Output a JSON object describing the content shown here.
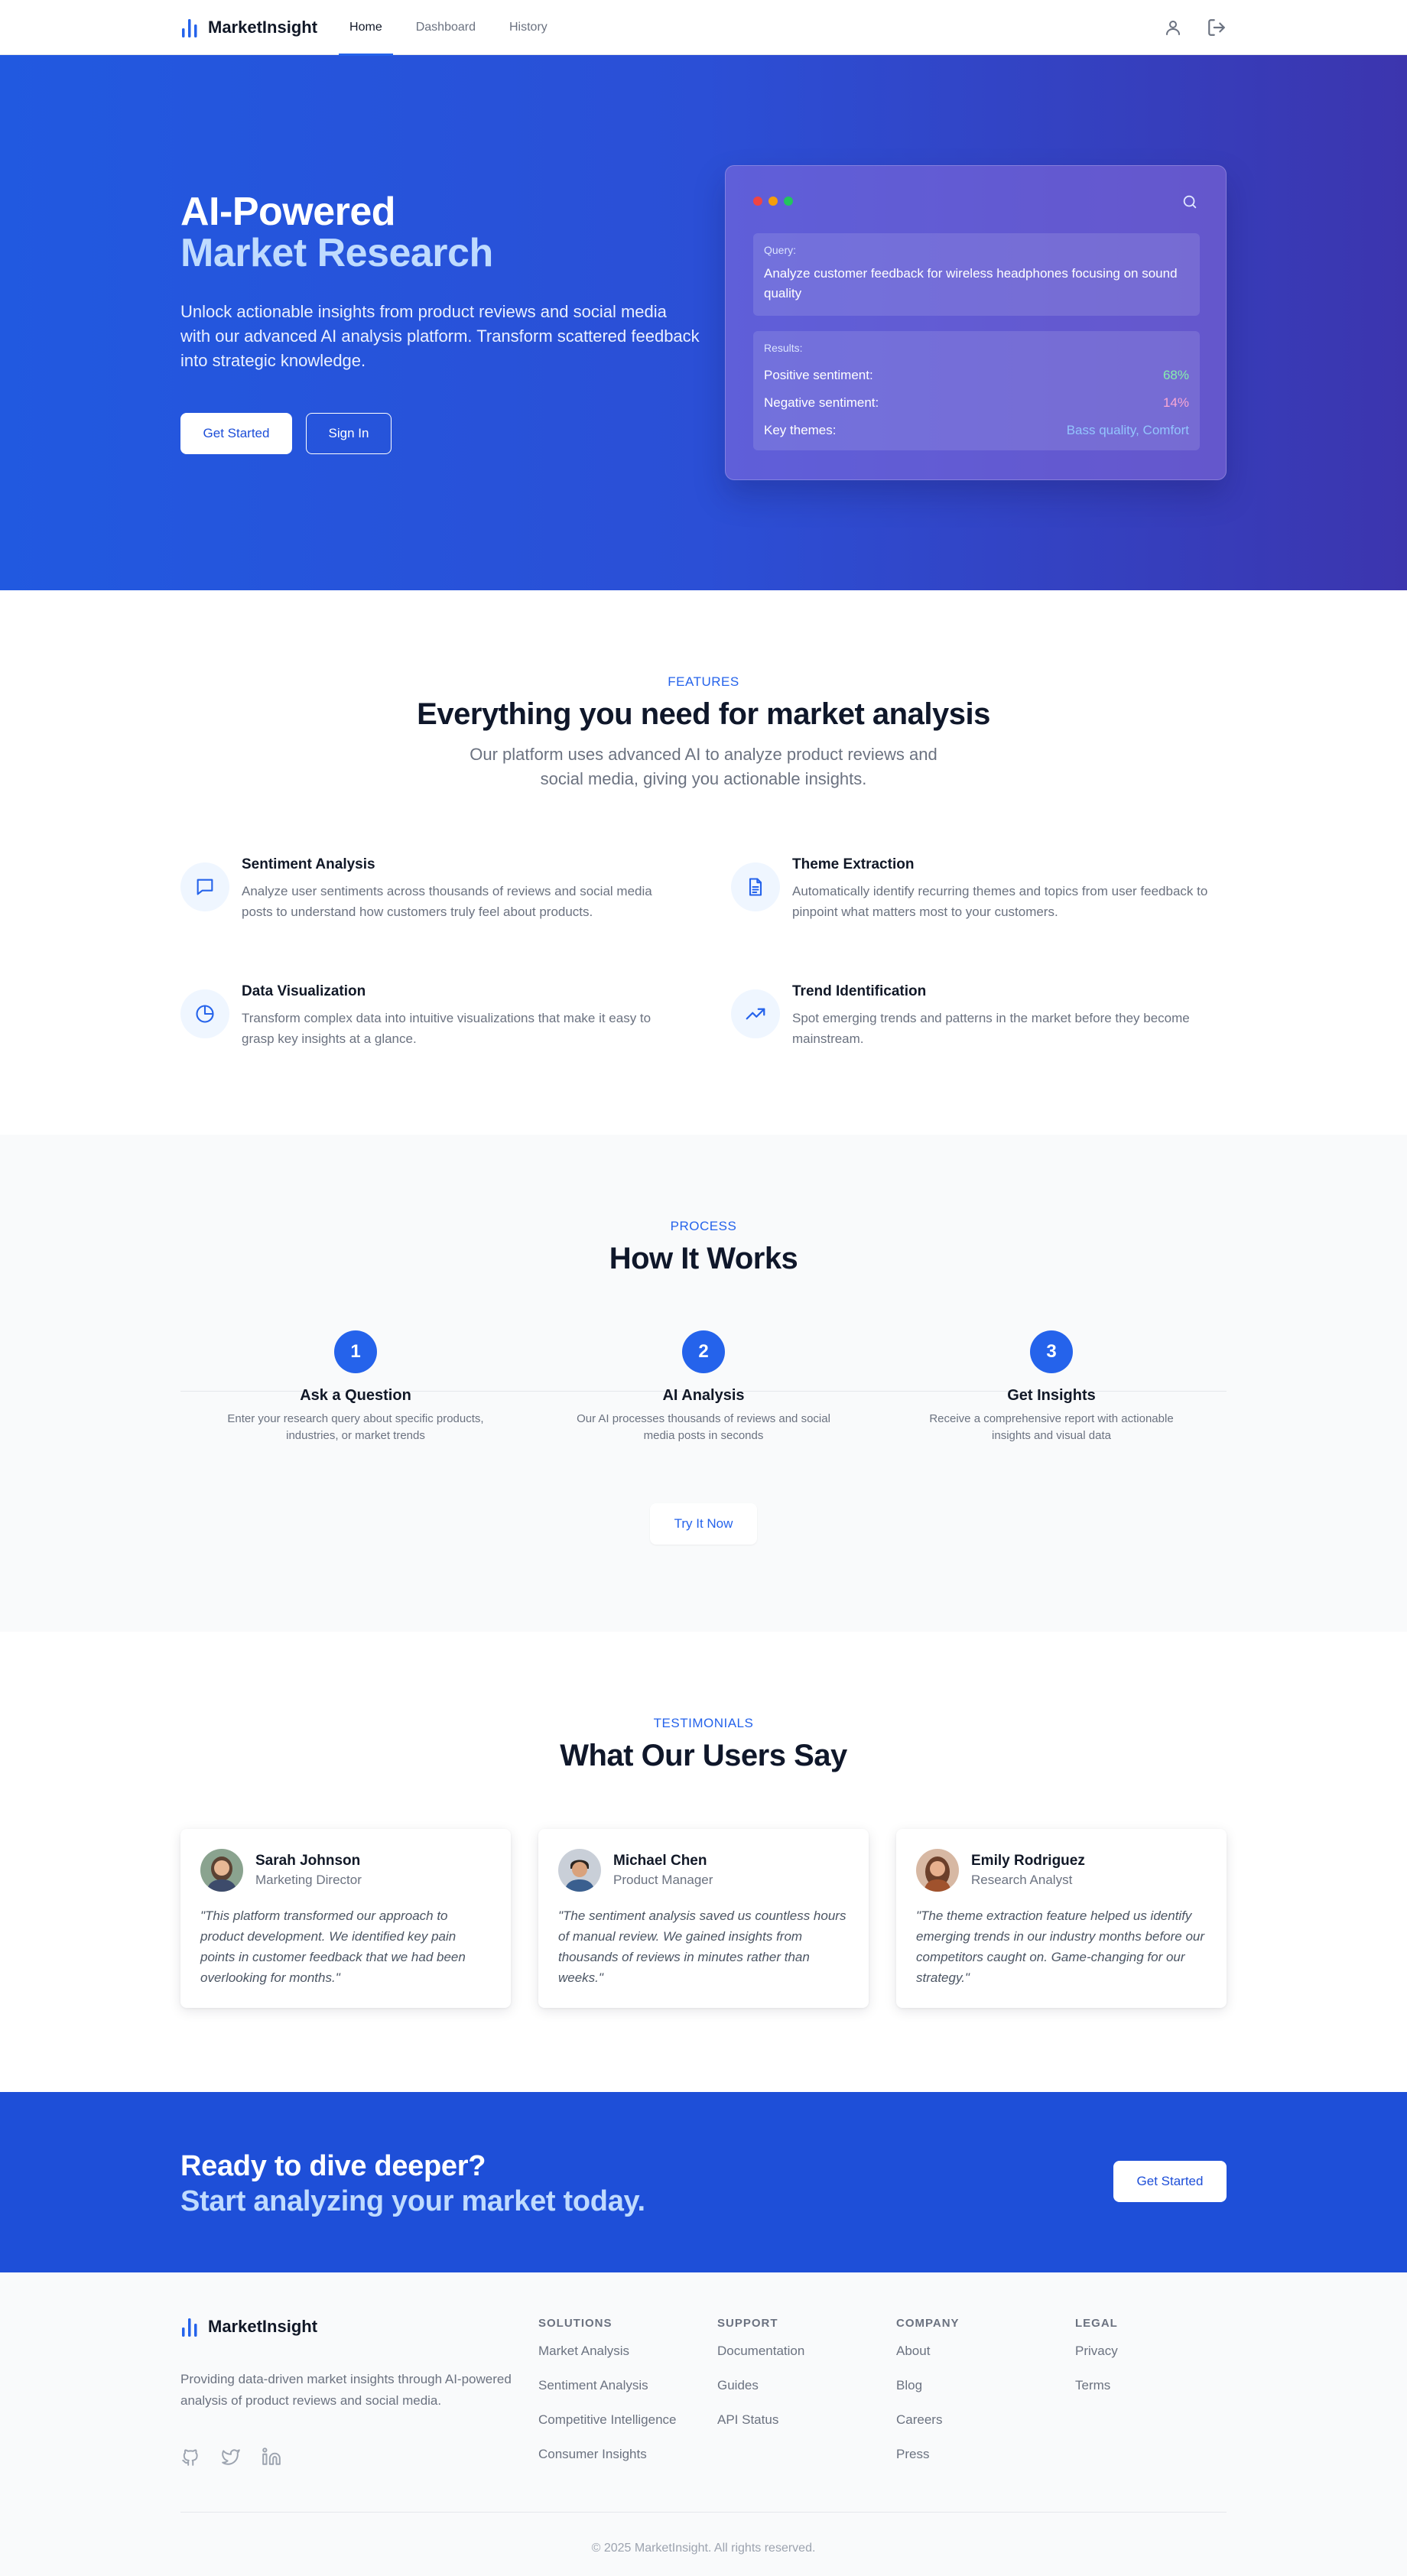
{
  "brand": {
    "name": "MarketInsight"
  },
  "colors": {
    "accent": "#2563eb",
    "hero_start": "#2159e0",
    "hero_end": "#3c35ae",
    "positive": "#86efac",
    "negative": "#f9a8d4",
    "themes": "#93c5fd"
  },
  "nav": {
    "links": [
      {
        "label": "Home",
        "active": true
      },
      {
        "label": "Dashboard",
        "active": false
      },
      {
        "label": "History",
        "active": false
      }
    ],
    "icons": [
      "user-icon",
      "logout-icon"
    ]
  },
  "hero": {
    "title_line1": "AI-Powered",
    "title_line2": "Market Research",
    "subtitle": "Unlock actionable insights from product reviews and social media with our advanced AI analysis platform. Transform scattered feedback into strategic knowledge.",
    "primary_button": "Get Started",
    "secondary_button": "Sign In",
    "demo": {
      "query_label": "Query:",
      "query_text": "Analyze customer feedback for wireless headphones focusing on sound quality",
      "results_label": "Results:",
      "results": [
        {
          "label": "Positive sentiment:",
          "value": "68%"
        },
        {
          "label": "Negative sentiment:",
          "value": "14%"
        },
        {
          "label": "Key themes:",
          "value": "Bass quality, Comfort"
        }
      ]
    }
  },
  "features": {
    "eyebrow": "FEATURES",
    "title": "Everything you need for market analysis",
    "subtitle": "Our platform uses advanced AI to analyze product reviews and social media, giving you actionable insights.",
    "items": [
      {
        "title": "Sentiment Analysis",
        "desc": "Analyze user sentiments across thousands of reviews and social media posts to understand how customers truly feel about products.",
        "icon": "chat-bubble-icon"
      },
      {
        "title": "Theme Extraction",
        "desc": "Automatically identify recurring themes and topics from user feedback to pinpoint what matters most to your customers.",
        "icon": "document-icon"
      },
      {
        "title": "Data Visualization",
        "desc": "Transform complex data into intuitive visualizations that make it easy to grasp key insights at a glance.",
        "icon": "pie-chart-icon"
      },
      {
        "title": "Trend Identification",
        "desc": "Spot emerging trends and patterns in the market before they become mainstream.",
        "icon": "trend-up-icon"
      }
    ]
  },
  "process": {
    "eyebrow": "PROCESS",
    "title": "How It Works",
    "steps": [
      {
        "num": "1",
        "title": "Ask a Question",
        "desc": "Enter your research query about specific products, industries, or market trends"
      },
      {
        "num": "2",
        "title": "AI Analysis",
        "desc": "Our AI processes thousands of reviews and social media posts in seconds"
      },
      {
        "num": "3",
        "title": "Get Insights",
        "desc": "Receive a comprehensive report with actionable insights and visual data"
      }
    ],
    "button": "Try It Now"
  },
  "testimonials": {
    "eyebrow": "TESTIMONIALS",
    "title": "What Our Users Say",
    "items": [
      {
        "name": "Sarah Johnson",
        "role": "Marketing Director",
        "quote": "\"This platform transformed our approach to product development. We identified key pain points in customer feedback that we had been overlooking for months.\""
      },
      {
        "name": "Michael Chen",
        "role": "Product Manager",
        "quote": "\"The sentiment analysis saved us countless hours of manual review. We gained insights from thousands of reviews in minutes rather than weeks.\""
      },
      {
        "name": "Emily Rodriguez",
        "role": "Research Analyst",
        "quote": "\"The theme extraction feature helped us identify emerging trends in our industry months before our competitors caught on. Game-changing for our strategy.\""
      }
    ]
  },
  "cta": {
    "line1": "Ready to dive deeper?",
    "line2": "Start analyzing your market today.",
    "button": "Get Started"
  },
  "footer": {
    "description": "Providing data-driven market insights through AI-powered analysis of product reviews and social media.",
    "social": [
      "github-icon",
      "twitter-icon",
      "linkedin-icon"
    ],
    "columns": [
      {
        "title": "SOLUTIONS",
        "links": [
          "Market Analysis",
          "Sentiment Analysis",
          "Competitive Intelligence",
          "Consumer Insights"
        ]
      },
      {
        "title": "SUPPORT",
        "links": [
          "Documentation",
          "Guides",
          "API Status"
        ]
      },
      {
        "title": "COMPANY",
        "links": [
          "About",
          "Blog",
          "Careers",
          "Press"
        ]
      },
      {
        "title": "LEGAL",
        "links": [
          "Privacy",
          "Terms"
        ]
      }
    ],
    "copyright": "© 2025 MarketInsight. All rights reserved."
  }
}
